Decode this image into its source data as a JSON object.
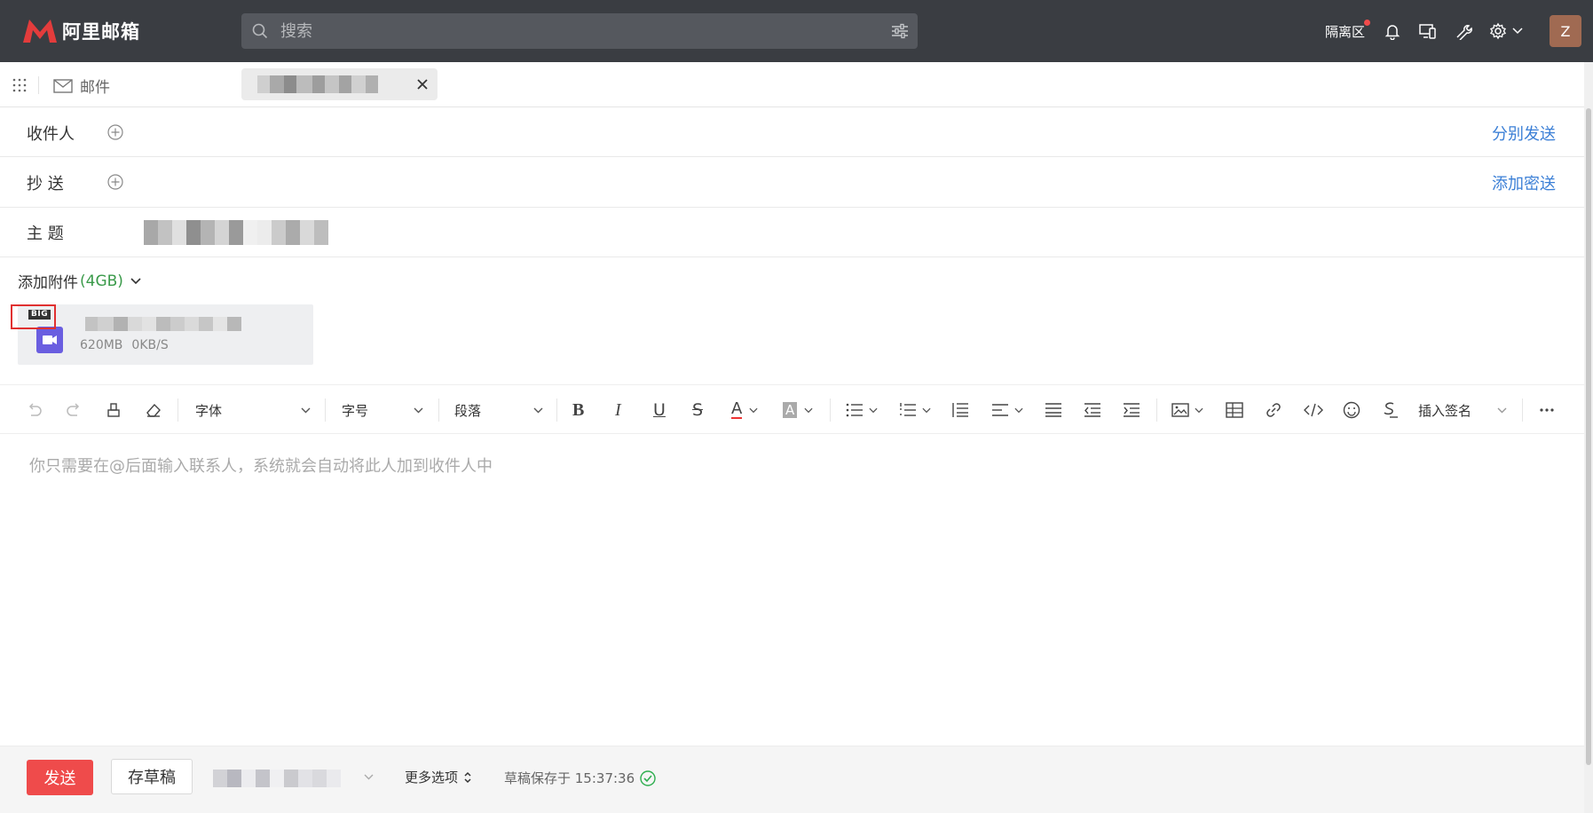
{
  "app": {
    "logo_text": "阿里邮箱",
    "brand_color": "#e33c3c"
  },
  "search": {
    "placeholder": "搜索",
    "icon": "search-icon",
    "filter_icon": "filter-icon"
  },
  "top_right": {
    "quarantine_label": "隔离区",
    "icons": [
      "bell-icon",
      "devices-icon",
      "wrench-icon",
      "gear-icon"
    ],
    "avatar_letter": "Z"
  },
  "tabs": {
    "mail_label": "邮件"
  },
  "compose": {
    "to_label": "收件人",
    "to_action": "分别发送",
    "cc_label": "抄 送",
    "cc_action": "添加密送",
    "subject_label": "主 题"
  },
  "attachments": {
    "label": "添加附件",
    "capacity": "(4GB)",
    "files": [
      {
        "badge": "BIG",
        "size": "620MB",
        "speed": "0KB/S",
        "type_icon": "video-icon"
      }
    ]
  },
  "toolbar": {
    "font_family": "字体",
    "font_size": "字号",
    "paragraph": "段落",
    "signature": "插入签名"
  },
  "editor": {
    "placeholder": "你只需要在@后面输入联系人，系统就会自动将此人加到收件人中"
  },
  "footer": {
    "send_label": "发送",
    "save_draft_label": "存草稿",
    "more_options_label": "更多选项",
    "draft_saved_text": "草稿保存于 15:37:36"
  }
}
